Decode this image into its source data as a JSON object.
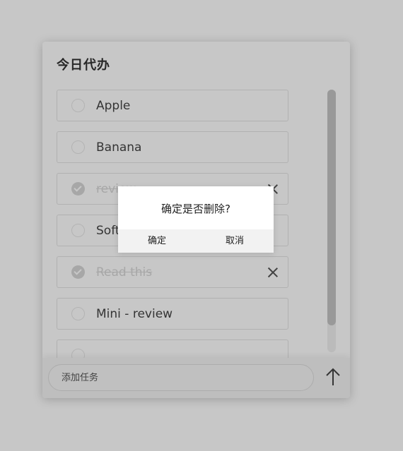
{
  "card": {
    "title": "今日代办"
  },
  "todos": [
    {
      "text": "Apple",
      "done": false,
      "show_delete": false
    },
    {
      "text": "Banana",
      "done": false,
      "show_delete": false
    },
    {
      "text": "review",
      "done": true,
      "show_delete": true
    },
    {
      "text": "Software",
      "done": false,
      "show_delete": false
    },
    {
      "text": "Read this",
      "done": true,
      "show_delete": true
    },
    {
      "text": "Mini - review",
      "done": false,
      "show_delete": false
    },
    {
      "text": "",
      "done": false,
      "show_delete": false
    }
  ],
  "input": {
    "placeholder": "添加任务",
    "value": ""
  },
  "icons": {
    "send": "arrow-up-icon",
    "delete": "close-icon",
    "check": "checkbox-icon"
  },
  "dialog": {
    "message": "确定是否删除?",
    "confirm_label": "确定",
    "cancel_label": "取消"
  },
  "colors": {
    "overlay": "#000000",
    "text": "#444444",
    "done_text": "#d6d6d6",
    "bottom_bar": "#f4f4f4"
  }
}
